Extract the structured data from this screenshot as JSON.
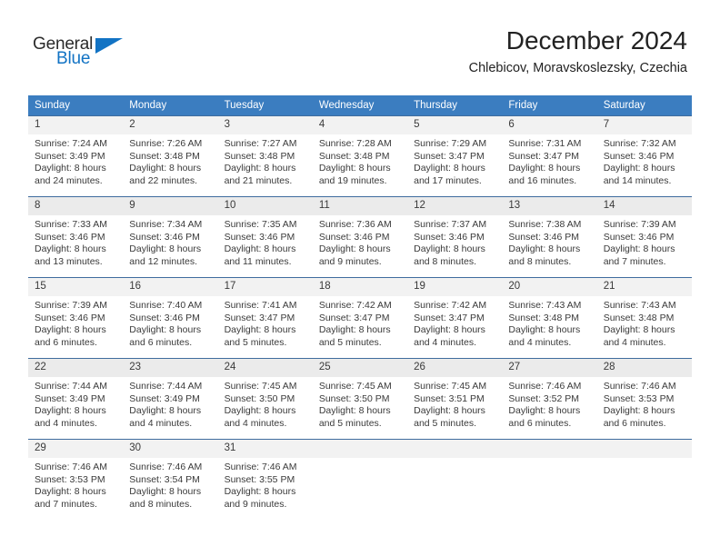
{
  "logo": {
    "word_one": "General",
    "word_two": "Blue",
    "triangle_color": "#1273c4"
  },
  "header": {
    "title": "December 2024",
    "subtitle": "Chlebicov, Moravskoslezsky, Czechia"
  },
  "theme": {
    "header_blue": "#3b7dc0",
    "row_rule": "#3f6c9e",
    "daynum_band": "#f2f2f2",
    "alt_daynum_band": "#ebebeb",
    "text": "#3a3a3a"
  },
  "weekday_headers": [
    "Sunday",
    "Monday",
    "Tuesday",
    "Wednesday",
    "Thursday",
    "Friday",
    "Saturday"
  ],
  "weeks": [
    [
      {
        "day": "1",
        "sunrise": "Sunrise: 7:24 AM",
        "sunset": "Sunset: 3:49 PM",
        "daylight_1": "Daylight: 8 hours",
        "daylight_2": "and 24 minutes."
      },
      {
        "day": "2",
        "sunrise": "Sunrise: 7:26 AM",
        "sunset": "Sunset: 3:48 PM",
        "daylight_1": "Daylight: 8 hours",
        "daylight_2": "and 22 minutes."
      },
      {
        "day": "3",
        "sunrise": "Sunrise: 7:27 AM",
        "sunset": "Sunset: 3:48 PM",
        "daylight_1": "Daylight: 8 hours",
        "daylight_2": "and 21 minutes."
      },
      {
        "day": "4",
        "sunrise": "Sunrise: 7:28 AM",
        "sunset": "Sunset: 3:48 PM",
        "daylight_1": "Daylight: 8 hours",
        "daylight_2": "and 19 minutes."
      },
      {
        "day": "5",
        "sunrise": "Sunrise: 7:29 AM",
        "sunset": "Sunset: 3:47 PM",
        "daylight_1": "Daylight: 8 hours",
        "daylight_2": "and 17 minutes."
      },
      {
        "day": "6",
        "sunrise": "Sunrise: 7:31 AM",
        "sunset": "Sunset: 3:47 PM",
        "daylight_1": "Daylight: 8 hours",
        "daylight_2": "and 16 minutes."
      },
      {
        "day": "7",
        "sunrise": "Sunrise: 7:32 AM",
        "sunset": "Sunset: 3:46 PM",
        "daylight_1": "Daylight: 8 hours",
        "daylight_2": "and 14 minutes."
      }
    ],
    [
      {
        "day": "8",
        "sunrise": "Sunrise: 7:33 AM",
        "sunset": "Sunset: 3:46 PM",
        "daylight_1": "Daylight: 8 hours",
        "daylight_2": "and 13 minutes."
      },
      {
        "day": "9",
        "sunrise": "Sunrise: 7:34 AM",
        "sunset": "Sunset: 3:46 PM",
        "daylight_1": "Daylight: 8 hours",
        "daylight_2": "and 12 minutes."
      },
      {
        "day": "10",
        "sunrise": "Sunrise: 7:35 AM",
        "sunset": "Sunset: 3:46 PM",
        "daylight_1": "Daylight: 8 hours",
        "daylight_2": "and 11 minutes."
      },
      {
        "day": "11",
        "sunrise": "Sunrise: 7:36 AM",
        "sunset": "Sunset: 3:46 PM",
        "daylight_1": "Daylight: 8 hours",
        "daylight_2": "and 9 minutes."
      },
      {
        "day": "12",
        "sunrise": "Sunrise: 7:37 AM",
        "sunset": "Sunset: 3:46 PM",
        "daylight_1": "Daylight: 8 hours",
        "daylight_2": "and 8 minutes."
      },
      {
        "day": "13",
        "sunrise": "Sunrise: 7:38 AM",
        "sunset": "Sunset: 3:46 PM",
        "daylight_1": "Daylight: 8 hours",
        "daylight_2": "and 8 minutes."
      },
      {
        "day": "14",
        "sunrise": "Sunrise: 7:39 AM",
        "sunset": "Sunset: 3:46 PM",
        "daylight_1": "Daylight: 8 hours",
        "daylight_2": "and 7 minutes."
      }
    ],
    [
      {
        "day": "15",
        "sunrise": "Sunrise: 7:39 AM",
        "sunset": "Sunset: 3:46 PM",
        "daylight_1": "Daylight: 8 hours",
        "daylight_2": "and 6 minutes."
      },
      {
        "day": "16",
        "sunrise": "Sunrise: 7:40 AM",
        "sunset": "Sunset: 3:46 PM",
        "daylight_1": "Daylight: 8 hours",
        "daylight_2": "and 6 minutes."
      },
      {
        "day": "17",
        "sunrise": "Sunrise: 7:41 AM",
        "sunset": "Sunset: 3:47 PM",
        "daylight_1": "Daylight: 8 hours",
        "daylight_2": "and 5 minutes."
      },
      {
        "day": "18",
        "sunrise": "Sunrise: 7:42 AM",
        "sunset": "Sunset: 3:47 PM",
        "daylight_1": "Daylight: 8 hours",
        "daylight_2": "and 5 minutes."
      },
      {
        "day": "19",
        "sunrise": "Sunrise: 7:42 AM",
        "sunset": "Sunset: 3:47 PM",
        "daylight_1": "Daylight: 8 hours",
        "daylight_2": "and 4 minutes."
      },
      {
        "day": "20",
        "sunrise": "Sunrise: 7:43 AM",
        "sunset": "Sunset: 3:48 PM",
        "daylight_1": "Daylight: 8 hours",
        "daylight_2": "and 4 minutes."
      },
      {
        "day": "21",
        "sunrise": "Sunrise: 7:43 AM",
        "sunset": "Sunset: 3:48 PM",
        "daylight_1": "Daylight: 8 hours",
        "daylight_2": "and 4 minutes."
      }
    ],
    [
      {
        "day": "22",
        "sunrise": "Sunrise: 7:44 AM",
        "sunset": "Sunset: 3:49 PM",
        "daylight_1": "Daylight: 8 hours",
        "daylight_2": "and 4 minutes."
      },
      {
        "day": "23",
        "sunrise": "Sunrise: 7:44 AM",
        "sunset": "Sunset: 3:49 PM",
        "daylight_1": "Daylight: 8 hours",
        "daylight_2": "and 4 minutes."
      },
      {
        "day": "24",
        "sunrise": "Sunrise: 7:45 AM",
        "sunset": "Sunset: 3:50 PM",
        "daylight_1": "Daylight: 8 hours",
        "daylight_2": "and 4 minutes."
      },
      {
        "day": "25",
        "sunrise": "Sunrise: 7:45 AM",
        "sunset": "Sunset: 3:50 PM",
        "daylight_1": "Daylight: 8 hours",
        "daylight_2": "and 5 minutes."
      },
      {
        "day": "26",
        "sunrise": "Sunrise: 7:45 AM",
        "sunset": "Sunset: 3:51 PM",
        "daylight_1": "Daylight: 8 hours",
        "daylight_2": "and 5 minutes."
      },
      {
        "day": "27",
        "sunrise": "Sunrise: 7:46 AM",
        "sunset": "Sunset: 3:52 PM",
        "daylight_1": "Daylight: 8 hours",
        "daylight_2": "and 6 minutes."
      },
      {
        "day": "28",
        "sunrise": "Sunrise: 7:46 AM",
        "sunset": "Sunset: 3:53 PM",
        "daylight_1": "Daylight: 8 hours",
        "daylight_2": "and 6 minutes."
      }
    ],
    [
      {
        "day": "29",
        "sunrise": "Sunrise: 7:46 AM",
        "sunset": "Sunset: 3:53 PM",
        "daylight_1": "Daylight: 8 hours",
        "daylight_2": "and 7 minutes."
      },
      {
        "day": "30",
        "sunrise": "Sunrise: 7:46 AM",
        "sunset": "Sunset: 3:54 PM",
        "daylight_1": "Daylight: 8 hours",
        "daylight_2": "and 8 minutes."
      },
      {
        "day": "31",
        "sunrise": "Sunrise: 7:46 AM",
        "sunset": "Sunset: 3:55 PM",
        "daylight_1": "Daylight: 8 hours",
        "daylight_2": "and 9 minutes."
      },
      {
        "day": "",
        "sunrise": "",
        "sunset": "",
        "daylight_1": "",
        "daylight_2": ""
      },
      {
        "day": "",
        "sunrise": "",
        "sunset": "",
        "daylight_1": "",
        "daylight_2": ""
      },
      {
        "day": "",
        "sunrise": "",
        "sunset": "",
        "daylight_1": "",
        "daylight_2": ""
      },
      {
        "day": "",
        "sunrise": "",
        "sunset": "",
        "daylight_1": "",
        "daylight_2": ""
      }
    ]
  ]
}
